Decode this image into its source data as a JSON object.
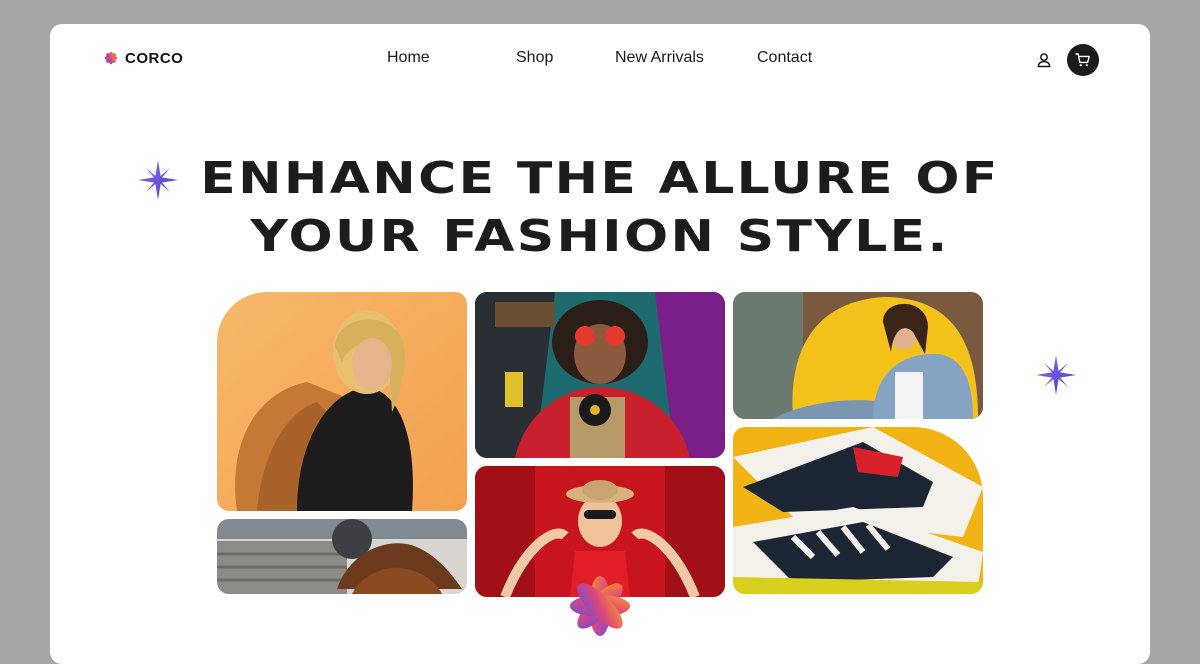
{
  "brand": {
    "name": "CORCO"
  },
  "nav": {
    "items": [
      {
        "label": "Home"
      },
      {
        "label": "Shop"
      },
      {
        "label": "New Arrivals"
      },
      {
        "label": "Contact"
      }
    ]
  },
  "header_actions": {
    "user_icon": "user-icon",
    "cart_icon": "cart-icon"
  },
  "hero": {
    "title_line1": "ENHANCE THE ALLURE OF",
    "title_line2": "YOUR FASHION STYLE."
  },
  "gallery": {
    "images": [
      {
        "name": "woman-orange-jacket-photo"
      },
      {
        "name": "leather-shoes-sweaters-photo"
      },
      {
        "name": "man-headphones-vinyl-photo"
      },
      {
        "name": "woman-red-dress-hat-photo"
      },
      {
        "name": "woman-denim-yellow-chair-photo"
      },
      {
        "name": "sneakers-yellow-background-photo"
      }
    ]
  },
  "colors": {
    "page_bg": "#a6a6a6",
    "card_bg": "#ffffff",
    "text": "#1c1c1c",
    "accent_purple": "#6a4fd8",
    "accent_pink": "#e0457b",
    "accent_orange": "#f39a2b"
  }
}
